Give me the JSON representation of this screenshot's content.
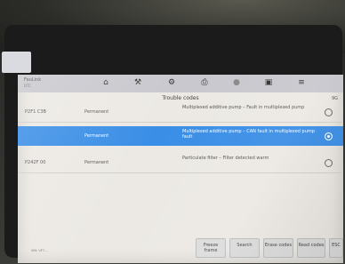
{
  "sticker": {
    "text": ""
  },
  "app": {
    "title": "FeuLink",
    "subtitle": "DTC",
    "toolbar_icons": [
      "home-icon",
      "tools-icon",
      "settings-icon",
      "print-icon",
      "help-icon",
      "save-icon",
      "exit-icon"
    ]
  },
  "page": {
    "title": "Trouble codes",
    "right": "9G"
  },
  "rows": [
    {
      "code": "P2F1 C3B",
      "status": "Permanent",
      "description": "Multiplexed additive pump – Fault in multiplexed pump"
    },
    {
      "code": "",
      "status": "Permanent",
      "description": "Multiplexed additive pump – CAN fault in multiplexed pump fault"
    },
    {
      "code": "P242F 00",
      "status": "Permanent",
      "description": "Particulate filter – Filter detected warm"
    }
  ],
  "footer": {
    "line1": "VIN: VF7...",
    "line2": ""
  },
  "buttons": {
    "freeze": "Freeze frame",
    "search": "Search",
    "erase": "Erase codes",
    "read": "Read codes",
    "esc": "ESC"
  },
  "colors": {
    "selected_row": "#3a8ee6"
  }
}
